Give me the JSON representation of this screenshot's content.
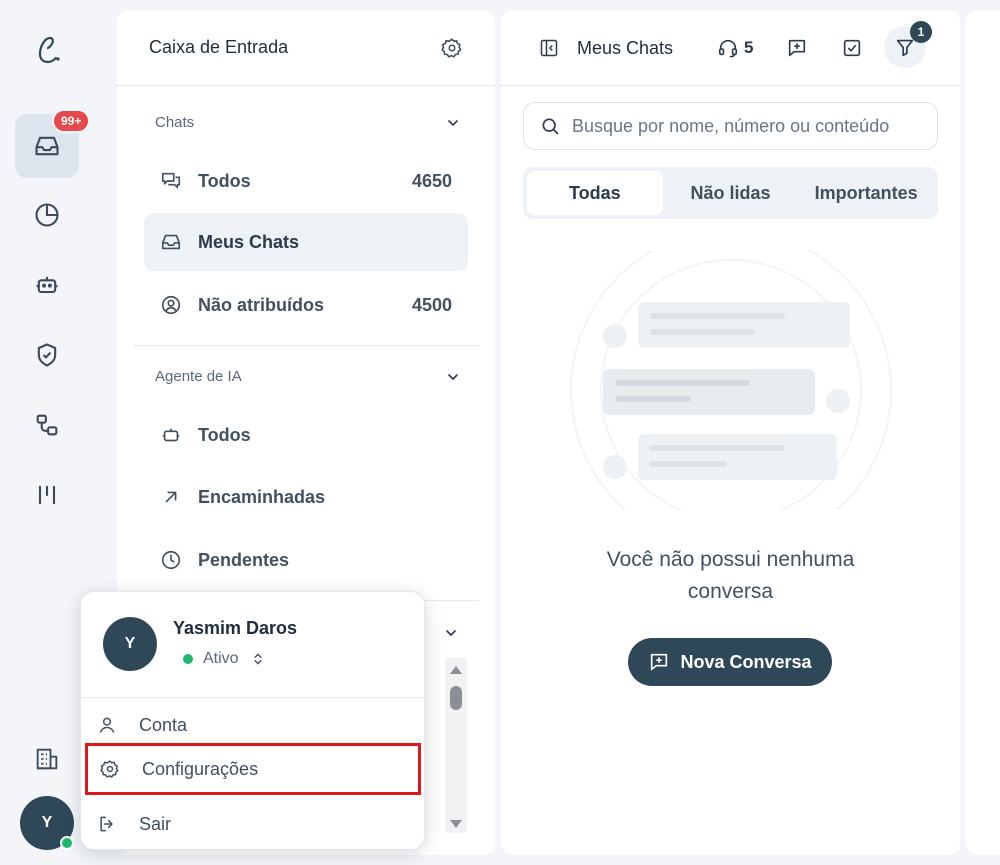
{
  "rail": {
    "logo": "ℓ",
    "notification_badge": "99+",
    "avatar_initial": "Y",
    "items": [
      {
        "name": "inbox-icon",
        "active": true
      },
      {
        "name": "chart-pie-icon"
      },
      {
        "name": "bot-icon"
      },
      {
        "name": "shield-check-icon"
      },
      {
        "name": "workflow-icon"
      },
      {
        "name": "kanban-icon"
      },
      {
        "name": "building-icon"
      }
    ]
  },
  "inbox": {
    "title": "Caixa de Entrada",
    "chats_section": "Chats",
    "items": [
      {
        "label": "Todos",
        "count": "4650"
      },
      {
        "label": "Meus Chats",
        "count": ""
      },
      {
        "label": "Não atribuídos",
        "count": "4500"
      }
    ],
    "ai_section": "Agente de IA",
    "ai_items": [
      {
        "label": "Todos"
      },
      {
        "label": "Encaminhadas"
      },
      {
        "label": "Pendentes"
      }
    ]
  },
  "chats": {
    "title": "Meus Chats",
    "agents_count": "5",
    "filter_badge": "1",
    "search_placeholder": "Busque por nome, número ou conteúdo",
    "tabs": [
      "Todas",
      "Não lidas",
      "Importantes"
    ],
    "empty_line1": "Você não possui nenhuma",
    "empty_line2": "conversa",
    "new_button": "Nova Conversa"
  },
  "user_menu": {
    "avatar_initial": "Y",
    "name": "Yasmim Daros",
    "status": "Ativo",
    "items": [
      "Conta",
      "Configurações",
      "Sair"
    ]
  },
  "colors": {
    "accent": "#2f4858",
    "badge_red": "#e5484d",
    "online_green": "#1fb96e",
    "highlight_red": "#e0161b"
  }
}
